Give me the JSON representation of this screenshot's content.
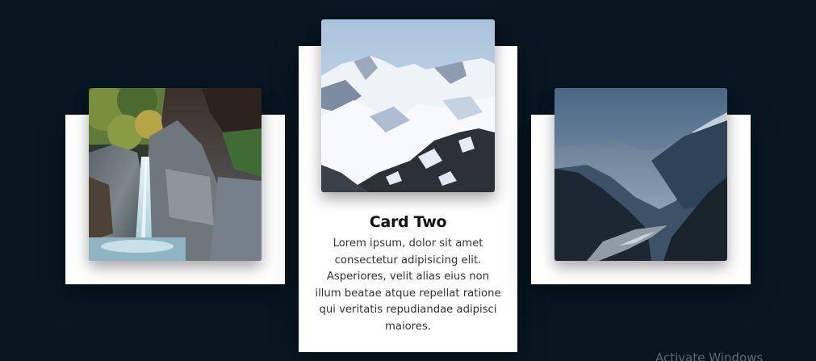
{
  "cards": [
    {
      "image": "waterfall-rock-photo"
    },
    {
      "image": "snowy-mountain-photo",
      "title": "Card Two",
      "body": "Lorem ipsum, dolor sit amet consectetur adipisicing elit. Asperiores, velit alias eius non illum beatae atque repellat ratione qui veritatis repudiandae adipisci maiores."
    },
    {
      "image": "mountain-valley-photo"
    }
  ],
  "watermark": "Activate Windows",
  "colors": {
    "background": "#071620",
    "card": "#ffffff",
    "title": "#111111",
    "body_text": "#333333"
  }
}
